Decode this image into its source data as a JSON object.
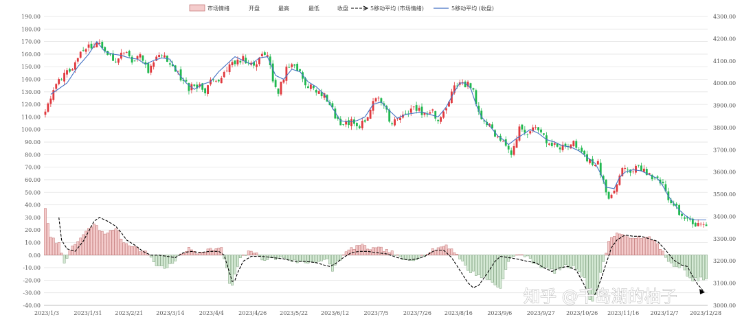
{
  "watermark": "知乎 @千岛湖的柚子",
  "chart_data": {
    "type": "candlestick+bar+line",
    "legend": [
      "市场情绪",
      "开盘",
      "最高",
      "最低",
      "收盘",
      "5移动平均 (市场情绪)",
      "5移动平均 (收盘)"
    ],
    "legend_position": "top-center",
    "x_tick_labels": [
      "2023/1/3",
      "2023/1/31",
      "2023/2/21",
      "2023/3/14",
      "2023/4/4",
      "2023/4/26",
      "2023/5/22",
      "2023/6/12",
      "2023/7/5",
      "2023/7/26",
      "2023/8/16",
      "2023/9/6",
      "2023/9/27",
      "2023/10/26",
      "2023/11/16",
      "2023/12/7",
      "2023/12/28"
    ],
    "left_axis": {
      "range": [
        -40,
        190
      ],
      "step": 10,
      "tick_labels": [
        "-40.00",
        "-30.00",
        "-20.00",
        "-10.00",
        "0.00",
        "10.00",
        "20.00",
        "30.00",
        "40.00",
        "50.00",
        "60.00",
        "70.00",
        "80.00",
        "90.00",
        "100.00",
        "110.00",
        "120.00",
        "130.00",
        "140.00",
        "150.00",
        "160.00",
        "170.00",
        "180.00",
        "190.00"
      ]
    },
    "right_axis": {
      "range": [
        3000,
        4300
      ],
      "step": 100,
      "tick_labels": [
        "3000.00",
        "3100.00",
        "3200.00",
        "3300.00",
        "3400.00",
        "3500.00",
        "3600.00",
        "3700.00",
        "3800.00",
        "3900.00",
        "4000.00",
        "4100.00",
        "4200.00",
        "4300.00"
      ]
    },
    "colors": {
      "up": "#e0393e",
      "down": "#1fb84f",
      "bar_pos": "#f4cccc",
      "bar_pos_edge": "#c07070",
      "bar_neg": "#d6ead6",
      "bar_neg_edge": "#7aa07a",
      "ma_close": "#4472c4",
      "ma_sentiment": "#000000"
    },
    "candle_anchors": [
      [
        0,
        112
      ],
      [
        3,
        132
      ],
      [
        6,
        142
      ],
      [
        10,
        150
      ],
      [
        13,
        162
      ],
      [
        18,
        168
      ],
      [
        20,
        170
      ],
      [
        23,
        158
      ],
      [
        26,
        155
      ],
      [
        29,
        163
      ],
      [
        32,
        152
      ],
      [
        35,
        160
      ],
      [
        38,
        147
      ],
      [
        41,
        160
      ],
      [
        44,
        158
      ],
      [
        47,
        152
      ],
      [
        50,
        140
      ],
      [
        53,
        133
      ],
      [
        56,
        135
      ],
      [
        59,
        130
      ],
      [
        62,
        140
      ],
      [
        65,
        140
      ],
      [
        68,
        150
      ],
      [
        71,
        157
      ],
      [
        74,
        155
      ],
      [
        77,
        150
      ],
      [
        80,
        163
      ],
      [
        82,
        160
      ],
      [
        84,
        138
      ],
      [
        86,
        130
      ],
      [
        89,
        148
      ],
      [
        92,
        152
      ],
      [
        95,
        140
      ],
      [
        98,
        133
      ],
      [
        101,
        130
      ],
      [
        104,
        125
      ],
      [
        107,
        110
      ],
      [
        110,
        102
      ],
      [
        113,
        108
      ],
      [
        116,
        103
      ],
      [
        120,
        115
      ],
      [
        122,
        127
      ],
      [
        125,
        120
      ],
      [
        127,
        107
      ],
      [
        131,
        107
      ],
      [
        134,
        115
      ],
      [
        137,
        116
      ],
      [
        140,
        112
      ],
      [
        143,
        113
      ],
      [
        146,
        108
      ],
      [
        149,
        125
      ],
      [
        152,
        136
      ],
      [
        154,
        138
      ],
      [
        156,
        135
      ],
      [
        158,
        130
      ],
      [
        160,
        113
      ],
      [
        162,
        107
      ],
      [
        165,
        100
      ],
      [
        168,
        92
      ],
      [
        170,
        90
      ],
      [
        172,
        82
      ],
      [
        175,
        100
      ],
      [
        178,
        98
      ],
      [
        180,
        102
      ],
      [
        183,
        95
      ],
      [
        186,
        90
      ],
      [
        189,
        88
      ],
      [
        192,
        85
      ],
      [
        195,
        88
      ],
      [
        198,
        82
      ],
      [
        201,
        75
      ],
      [
        204,
        72
      ],
      [
        206,
        58
      ],
      [
        208,
        45
      ],
      [
        211,
        58
      ],
      [
        213,
        69
      ],
      [
        215,
        67
      ],
      [
        218,
        70
      ],
      [
        221,
        68
      ],
      [
        224,
        63
      ],
      [
        227,
        60
      ],
      [
        229,
        52
      ],
      [
        231,
        40
      ],
      [
        233,
        37
      ],
      [
        235,
        30
      ],
      [
        237,
        28
      ],
      [
        239,
        24
      ]
    ],
    "close_ma_anchors": [
      [
        2,
        128
      ],
      [
        8,
        137
      ],
      [
        12,
        150
      ],
      [
        16,
        160
      ],
      [
        19,
        170
      ],
      [
        22,
        162
      ],
      [
        25,
        160
      ],
      [
        28,
        159
      ],
      [
        31,
        157
      ],
      [
        34,
        156
      ],
      [
        37,
        152
      ],
      [
        40,
        155
      ],
      [
        43,
        157
      ],
      [
        46,
        156
      ],
      [
        49,
        145
      ],
      [
        52,
        137
      ],
      [
        55,
        132
      ],
      [
        58,
        136
      ],
      [
        61,
        138
      ],
      [
        64,
        146
      ],
      [
        67,
        152
      ],
      [
        70,
        158
      ],
      [
        73,
        155
      ],
      [
        76,
        152
      ],
      [
        79,
        157
      ],
      [
        82,
        158
      ],
      [
        85,
        143
      ],
      [
        88,
        140
      ],
      [
        91,
        148
      ],
      [
        94,
        146
      ],
      [
        97,
        138
      ],
      [
        100,
        134
      ],
      [
        103,
        128
      ],
      [
        106,
        117
      ],
      [
        109,
        107
      ],
      [
        112,
        106
      ],
      [
        115,
        107
      ],
      [
        118,
        110
      ],
      [
        121,
        120
      ],
      [
        124,
        122
      ],
      [
        127,
        115
      ],
      [
        130,
        109
      ],
      [
        133,
        112
      ],
      [
        136,
        113
      ],
      [
        139,
        114
      ],
      [
        142,
        112
      ],
      [
        145,
        110
      ],
      [
        148,
        118
      ],
      [
        151,
        130
      ],
      [
        153,
        137
      ],
      [
        155,
        137
      ],
      [
        157,
        133
      ],
      [
        159,
        120
      ],
      [
        161,
        110
      ],
      [
        164,
        103
      ],
      [
        167,
        95
      ],
      [
        169,
        92
      ],
      [
        171,
        88
      ],
      [
        174,
        93
      ],
      [
        177,
        97
      ],
      [
        179,
        100
      ],
      [
        182,
        97
      ],
      [
        185,
        92
      ],
      [
        188,
        90
      ],
      [
        191,
        87
      ],
      [
        194,
        86
      ],
      [
        197,
        83
      ],
      [
        200,
        78
      ],
      [
        203,
        73
      ],
      [
        205,
        65
      ],
      [
        207,
        54
      ],
      [
        210,
        53
      ],
      [
        212,
        62
      ],
      [
        214,
        66
      ],
      [
        217,
        68
      ],
      [
        220,
        67
      ],
      [
        223,
        64
      ],
      [
        226,
        61
      ],
      [
        228,
        55
      ],
      [
        230,
        47
      ],
      [
        232,
        41
      ],
      [
        234,
        36
      ],
      [
        236,
        32
      ],
      [
        238,
        29
      ],
      [
        240,
        28
      ],
      [
        241,
        28
      ]
    ],
    "sentiment_anchors": [
      [
        0,
        38
      ],
      [
        1,
        24
      ],
      [
        2,
        14
      ],
      [
        5,
        9
      ],
      [
        7,
        -5
      ],
      [
        10,
        6
      ],
      [
        14,
        16
      ],
      [
        18,
        25
      ],
      [
        20,
        20
      ],
      [
        23,
        17
      ],
      [
        26,
        22
      ],
      [
        29,
        10
      ],
      [
        32,
        8
      ],
      [
        35,
        4
      ],
      [
        38,
        1
      ],
      [
        41,
        -8
      ],
      [
        44,
        -10
      ],
      [
        47,
        -7
      ],
      [
        50,
        1
      ],
      [
        53,
        5
      ],
      [
        56,
        2
      ],
      [
        59,
        4
      ],
      [
        62,
        5
      ],
      [
        65,
        5
      ],
      [
        67,
        -10
      ],
      [
        68,
        -23
      ],
      [
        69,
        -25
      ],
      [
        70,
        -15
      ],
      [
        72,
        -3
      ],
      [
        76,
        4
      ],
      [
        80,
        -3
      ],
      [
        84,
        -3
      ],
      [
        88,
        -2
      ],
      [
        92,
        -5
      ],
      [
        96,
        -6
      ],
      [
        100,
        -5
      ],
      [
        104,
        -4
      ],
      [
        106,
        -12
      ],
      [
        108,
        -5
      ],
      [
        112,
        4
      ],
      [
        116,
        8
      ],
      [
        120,
        5
      ],
      [
        124,
        5
      ],
      [
        128,
        2
      ],
      [
        132,
        -4
      ],
      [
        136,
        -3
      ],
      [
        140,
        0
      ],
      [
        144,
        5
      ],
      [
        148,
        8
      ],
      [
        152,
        1
      ],
      [
        156,
        -12
      ],
      [
        160,
        -16
      ],
      [
        164,
        -20
      ],
      [
        166,
        -23
      ],
      [
        168,
        -27
      ],
      [
        170,
        -10
      ],
      [
        172,
        -2
      ],
      [
        176,
        1
      ],
      [
        180,
        -5
      ],
      [
        184,
        -10
      ],
      [
        188,
        -13
      ],
      [
        192,
        -9
      ],
      [
        196,
        -10
      ],
      [
        199,
        -18
      ],
      [
        201,
        -36
      ],
      [
        202,
        -38
      ],
      [
        204,
        -25
      ],
      [
        206,
        -5
      ],
      [
        208,
        11
      ],
      [
        211,
        18
      ],
      [
        214,
        14
      ],
      [
        217,
        15
      ],
      [
        220,
        13
      ],
      [
        223,
        14
      ],
      [
        226,
        10
      ],
      [
        229,
        -2
      ],
      [
        232,
        -10
      ],
      [
        235,
        -8
      ],
      [
        237,
        -18
      ],
      [
        239,
        -20
      ],
      [
        241,
        -19
      ]
    ],
    "sentiment_ma_anchors": [
      [
        5,
        30
      ],
      [
        6,
        12
      ],
      [
        8,
        5
      ],
      [
        11,
        3
      ],
      [
        14,
        11
      ],
      [
        18,
        27
      ],
      [
        20,
        30
      ],
      [
        23,
        27
      ],
      [
        26,
        23
      ],
      [
        28,
        18
      ],
      [
        30,
        12
      ],
      [
        33,
        8
      ],
      [
        36,
        3
      ],
      [
        39,
        0
      ],
      [
        42,
        0
      ],
      [
        45,
        -1
      ],
      [
        48,
        -2
      ],
      [
        51,
        2
      ],
      [
        54,
        3
      ],
      [
        57,
        2
      ],
      [
        61,
        3
      ],
      [
        64,
        3
      ],
      [
        66,
        0
      ],
      [
        67,
        -7
      ],
      [
        68,
        -14
      ],
      [
        69,
        -21
      ],
      [
        70,
        -20
      ],
      [
        71,
        -14
      ],
      [
        73,
        -5
      ],
      [
        76,
        -1
      ],
      [
        80,
        -1
      ],
      [
        84,
        -2
      ],
      [
        88,
        -3
      ],
      [
        92,
        -5
      ],
      [
        96,
        -5
      ],
      [
        100,
        -6
      ],
      [
        103,
        -8
      ],
      [
        105,
        -9
      ],
      [
        107,
        -7
      ],
      [
        110,
        -2
      ],
      [
        113,
        2
      ],
      [
        116,
        3
      ],
      [
        119,
        3
      ],
      [
        122,
        2
      ],
      [
        126,
        1
      ],
      [
        130,
        -2
      ],
      [
        134,
        -4
      ],
      [
        137,
        -3
      ],
      [
        140,
        -1
      ],
      [
        144,
        4
      ],
      [
        147,
        4
      ],
      [
        150,
        -2
      ],
      [
        153,
        -12
      ],
      [
        156,
        -22
      ],
      [
        158,
        -26
      ],
      [
        160,
        -24
      ],
      [
        163,
        -15
      ],
      [
        166,
        -5
      ],
      [
        168,
        -1
      ],
      [
        171,
        -2
      ],
      [
        174,
        -3
      ],
      [
        178,
        -5
      ],
      [
        181,
        -6
      ],
      [
        184,
        -10
      ],
      [
        187,
        -13
      ],
      [
        190,
        -10
      ],
      [
        193,
        -9
      ],
      [
        196,
        -12
      ],
      [
        199,
        -24
      ],
      [
        201,
        -33
      ],
      [
        203,
        -31
      ],
      [
        205,
        -20
      ],
      [
        207,
        -7
      ],
      [
        209,
        6
      ],
      [
        211,
        12
      ],
      [
        214,
        16
      ],
      [
        217,
        15
      ],
      [
        220,
        15
      ],
      [
        223,
        13
      ],
      [
        226,
        11
      ],
      [
        229,
        4
      ],
      [
        232,
        -4
      ],
      [
        235,
        -8
      ],
      [
        237,
        -9
      ],
      [
        239,
        -17
      ],
      [
        241,
        -24
      ],
      [
        242,
        -26
      ],
      [
        243,
        -29
      ]
    ]
  }
}
